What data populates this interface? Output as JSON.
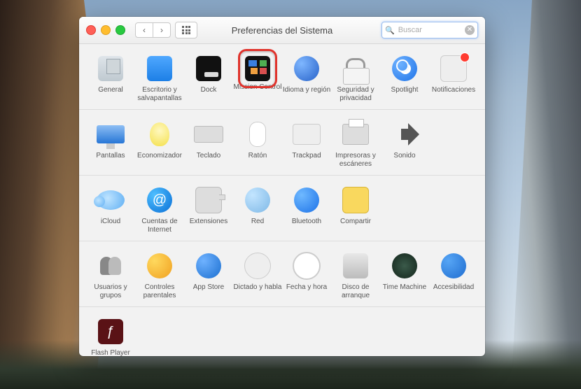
{
  "window": {
    "title": "Preferencias del Sistema"
  },
  "search": {
    "placeholder": "Buscar"
  },
  "sections": {
    "r1": {
      "general": "General",
      "desktop": "Escritorio y salvapantallas",
      "dock": "Dock",
      "mission": "Mission Control",
      "lang": "Idioma y región",
      "security": "Seguridad y privacidad",
      "spotlight": "Spotlight",
      "notif": "Notificaciones"
    },
    "r2": {
      "displays": "Pantallas",
      "energy": "Economizador",
      "keyboard": "Teclado",
      "mouse": "Ratón",
      "trackpad": "Trackpad",
      "printers": "Impresoras y escáneres",
      "sound": "Sonido"
    },
    "r3": {
      "icloud": "iCloud",
      "accounts": "Cuentas de Internet",
      "ext": "Extensiones",
      "network": "Red",
      "bluetooth": "Bluetooth",
      "sharing": "Compartir"
    },
    "r4": {
      "users": "Usuarios y grupos",
      "parental": "Controles parentales",
      "appstore": "App Store",
      "dictation": "Dictado y habla",
      "datetime": "Fecha y hora",
      "startup": "Disco de arranque",
      "tm": "Time Machine",
      "access": "Accesibilidad"
    },
    "r5": {
      "flash": "Flash Player"
    }
  },
  "highlighted": "mission",
  "badges": [
    "notif"
  ],
  "at_glyph": "@",
  "flash_glyph": "ƒ"
}
